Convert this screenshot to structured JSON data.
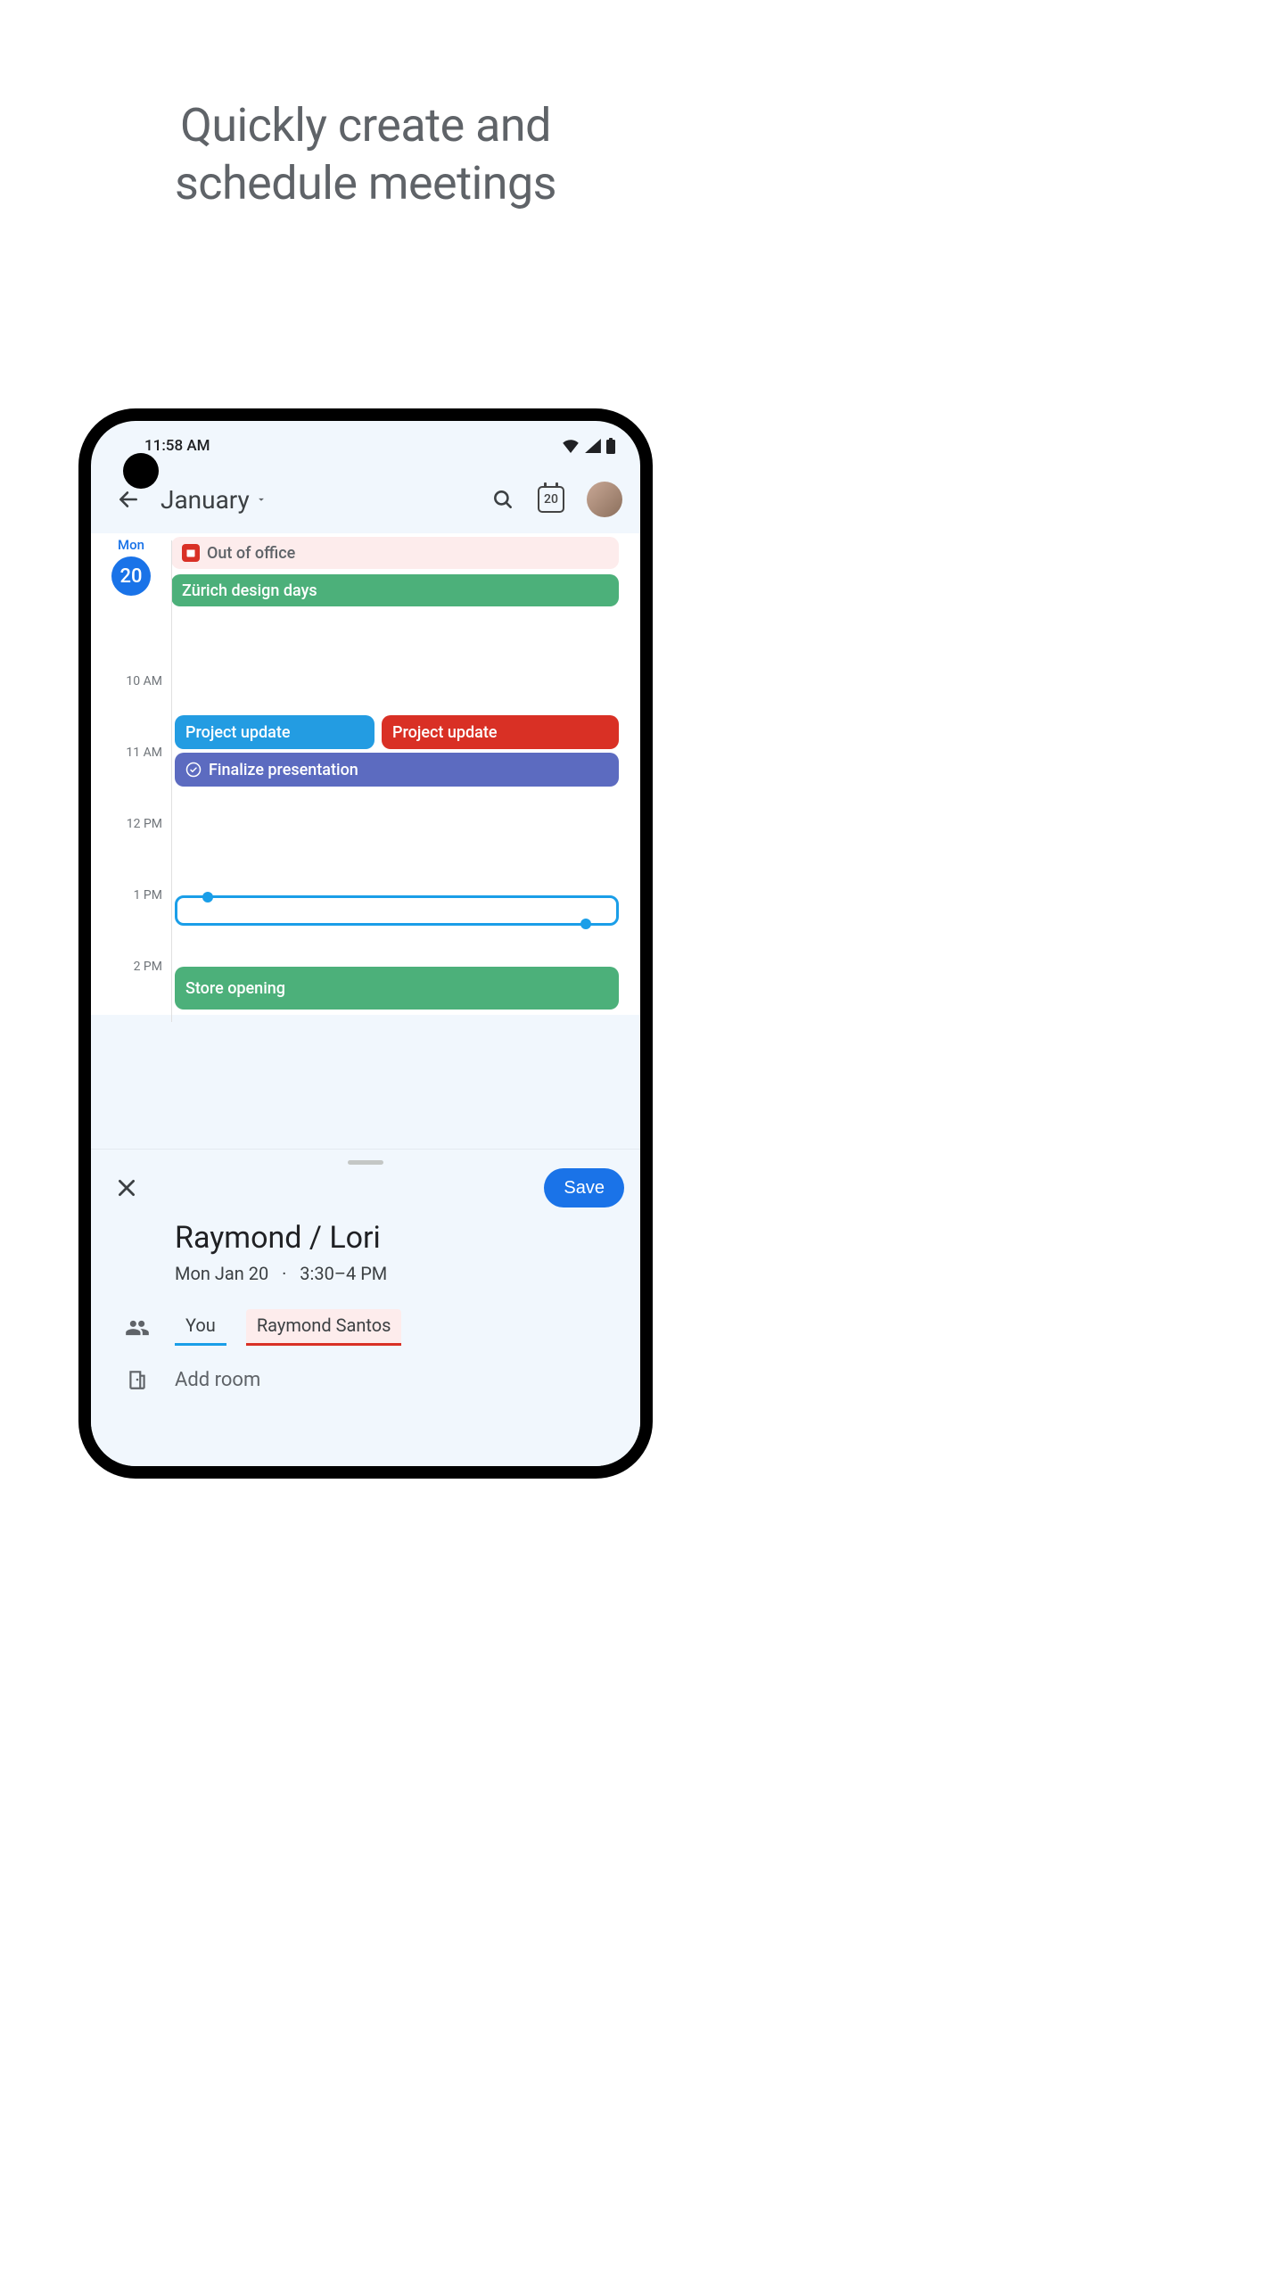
{
  "headline_l1": "Quickly create and",
  "headline_l2": "schedule meetings",
  "status": {
    "time": "11:58 AM"
  },
  "appbar": {
    "month": "January",
    "today_num": "20"
  },
  "day": {
    "name": "Mon",
    "num": "20"
  },
  "allday": {
    "ooo": "Out of office",
    "green": "Zürich design days"
  },
  "hours": [
    "10 AM",
    "11 AM",
    "12 PM",
    "1 PM",
    "2 PM"
  ],
  "events": {
    "proj1": "Project update",
    "proj2": "Project update",
    "finalize": "Finalize presentation",
    "store": "Store opening"
  },
  "sheet": {
    "save": "Save",
    "title": "Raymond / Lori",
    "date": "Mon Jan 20",
    "dot": "·",
    "time": "3:30–4 PM",
    "you": "You",
    "raymond": "Raymond Santos",
    "add_room": "Add room"
  }
}
